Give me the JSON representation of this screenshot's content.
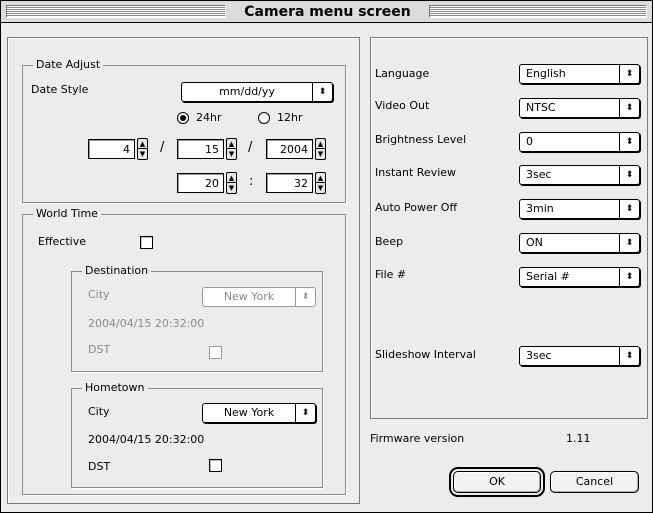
{
  "window": {
    "title": "Camera menu screen"
  },
  "date_adjust": {
    "title": "Date Adjust",
    "style_label": "Date Style",
    "style_value": "mm/dd/yy",
    "radio_24": "24hr",
    "radio_12": "12hr",
    "month": "4",
    "day": "15",
    "year": "2004",
    "date_sep": "/",
    "hour": "20",
    "minute": "32",
    "time_sep": ":"
  },
  "world_time": {
    "title": "World Time",
    "effective_label": "Effective",
    "destination": {
      "title": "Destination",
      "city_label": "City",
      "city_value": "New York",
      "datetime": "2004/04/15 20:32:00",
      "dst_label": "DST"
    },
    "hometown": {
      "title": "Hometown",
      "city_label": "City",
      "city_value": "New York",
      "datetime": "2004/04/15 20:32:00",
      "dst_label": "DST"
    }
  },
  "settings": {
    "language_label": "Language",
    "language_value": "English",
    "video_label": "Video Out",
    "video_value": "NTSC",
    "brightness_label": "Brightness Level",
    "brightness_value": "0",
    "review_label": "Instant Review",
    "review_value": "3sec",
    "power_label": "Auto Power Off",
    "power_value": "3min",
    "beep_label": "Beep",
    "beep_value": "ON",
    "file_label": "File #",
    "file_value": "Serial #",
    "slideshow_label": "Slideshow Interval",
    "slideshow_value": "3sec"
  },
  "firmware": {
    "label": "Firmware version",
    "value": "1.11"
  },
  "buttons": {
    "ok": "OK",
    "cancel": "Cancel"
  },
  "icons": {
    "popup_arrow": "⬍",
    "stepper_up": "▲",
    "stepper_down": "▼"
  }
}
